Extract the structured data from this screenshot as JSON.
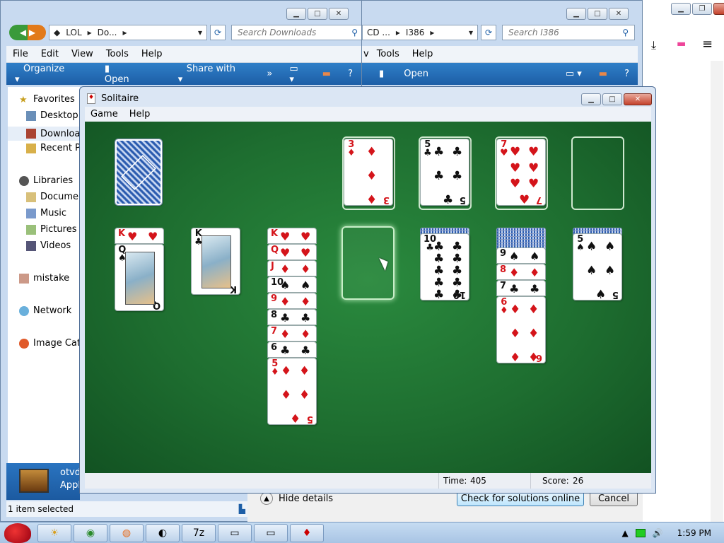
{
  "explorer_left": {
    "address_parts": [
      "LOL",
      "Do..."
    ],
    "search_placeholder": "Search Downloads",
    "menu": [
      "File",
      "Edit",
      "View",
      "Tools",
      "Help"
    ],
    "commands": [
      "Organize",
      "Open",
      "Share with",
      "»"
    ],
    "nav": [
      {
        "label": "Favorites",
        "icon": "star-icon"
      },
      {
        "label": "Desktop",
        "icon": "desktop-icon"
      },
      {
        "label": "Downloads",
        "icon": "download-folder-icon"
      },
      {
        "label": "Recent Places",
        "icon": "recent-icon"
      },
      {
        "label": "Libraries",
        "icon": "library-icon"
      },
      {
        "label": "Documents",
        "icon": "documents-icon"
      },
      {
        "label": "Music",
        "icon": "music-icon"
      },
      {
        "label": "Pictures",
        "icon": "pictures-icon"
      },
      {
        "label": "Videos",
        "icon": "videos-icon"
      },
      {
        "label": "mistake",
        "icon": "user-icon"
      },
      {
        "label": "Network",
        "icon": "network-icon"
      },
      {
        "label": "Image Catalog",
        "icon": "image-catalog-icon"
      }
    ],
    "preview_title": "otvd",
    "preview_sub": "Appl",
    "status": "1 item selected"
  },
  "explorer_right": {
    "address_parts": [
      "CD ...",
      "I386"
    ],
    "search_placeholder": "Search I386",
    "menu": [
      "v",
      "Tools",
      "Help"
    ],
    "commands": [
      "Open"
    ]
  },
  "dialog": {
    "hide_details": "Hide details",
    "check_button": "Check for solutions online",
    "cancel_button": "Cancel"
  },
  "solitaire": {
    "title": "Solitaire",
    "menu": [
      "Game",
      "Help"
    ],
    "time_label": "Time:",
    "time_value": "405",
    "score_label": "Score:",
    "score_value": "26",
    "foundations": [
      {
        "rank": "3",
        "suit": "♦",
        "color": "red"
      },
      {
        "rank": "5",
        "suit": "♣",
        "color": "black"
      },
      {
        "rank": "7",
        "suit": "♥",
        "color": "red"
      },
      {
        "rank": "",
        "suit": "",
        "color": "empty"
      }
    ],
    "tableau": [
      {
        "strips": [
          {
            "rank": "K",
            "suit": "♥",
            "color": "red"
          }
        ],
        "top": {
          "rank": "Q",
          "suit": "♠",
          "color": "black"
        }
      },
      {
        "strips": [],
        "top": {
          "rank": "K",
          "suit": "♣",
          "color": "black"
        }
      },
      {
        "strips": [
          {
            "rank": "K",
            "suit": "♥",
            "color": "red"
          },
          {
            "rank": "Q",
            "suit": "♥",
            "color": "red"
          },
          {
            "rank": "J",
            "suit": "♦",
            "color": "red"
          },
          {
            "rank": "10",
            "suit": "♠",
            "color": "black"
          },
          {
            "rank": "9",
            "suit": "♦",
            "color": "red"
          },
          {
            "rank": "8",
            "suit": "♣",
            "color": "black"
          },
          {
            "rank": "7",
            "suit": "♦",
            "color": "red"
          },
          {
            "rank": "6",
            "suit": "♣",
            "color": "black"
          }
        ],
        "top": {
          "rank": "5",
          "suit": "♦",
          "color": "red"
        }
      },
      {
        "strips": [],
        "top": null
      },
      {
        "strips": [],
        "top": {
          "rank": "10",
          "suit": "♣",
          "color": "black"
        }
      },
      {
        "strips": [
          {
            "rank": "9",
            "suit": "♠",
            "color": "black"
          },
          {
            "rank": "8",
            "suit": "♦",
            "color": "red"
          },
          {
            "rank": "7",
            "suit": "♣",
            "color": "black"
          }
        ],
        "top": {
          "rank": "6",
          "suit": "♦",
          "color": "red"
        }
      },
      {
        "strips": [],
        "top": {
          "rank": "5",
          "suit": "♠",
          "color": "black"
        }
      }
    ]
  },
  "taskbar": {
    "clock": "1:59 PM",
    "buttons": [
      "explorer-icon",
      "chrome-icon",
      "firefox-icon",
      "media-icon",
      "7zip-icon",
      "window-icon",
      "window-icon",
      "solitaire-icon"
    ]
  }
}
